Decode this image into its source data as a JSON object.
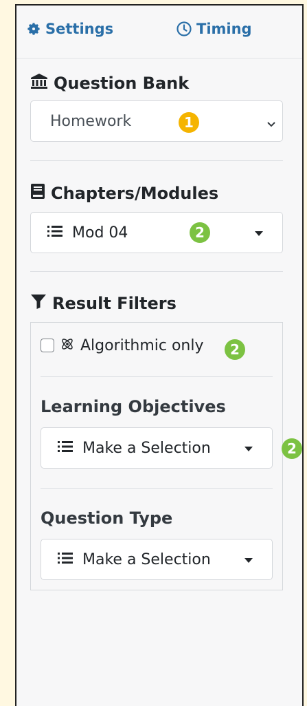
{
  "tabs": {
    "settings": "Settings",
    "timing": "Timing"
  },
  "question_bank": {
    "title": "Question Bank",
    "selected": "Homework",
    "badge": "1"
  },
  "chapters": {
    "title": "Chapters/Modules",
    "selected": "Mod 04",
    "badge": "2"
  },
  "result_filters": {
    "title": "Result Filters",
    "algorithmic_label": "Algorithmic only",
    "algorithmic_checked": false,
    "algorithmic_badge": "2",
    "learning_objectives": {
      "title": "Learning Objectives",
      "selected": "Make a Selection",
      "badge": "2"
    },
    "question_type": {
      "title": "Question Type",
      "selected": "Make a Selection"
    }
  },
  "colors": {
    "accent": "#2a6fa8",
    "badge_yellow": "#f5b400",
    "badge_green": "#7cc242",
    "background": "#fff8e1"
  }
}
